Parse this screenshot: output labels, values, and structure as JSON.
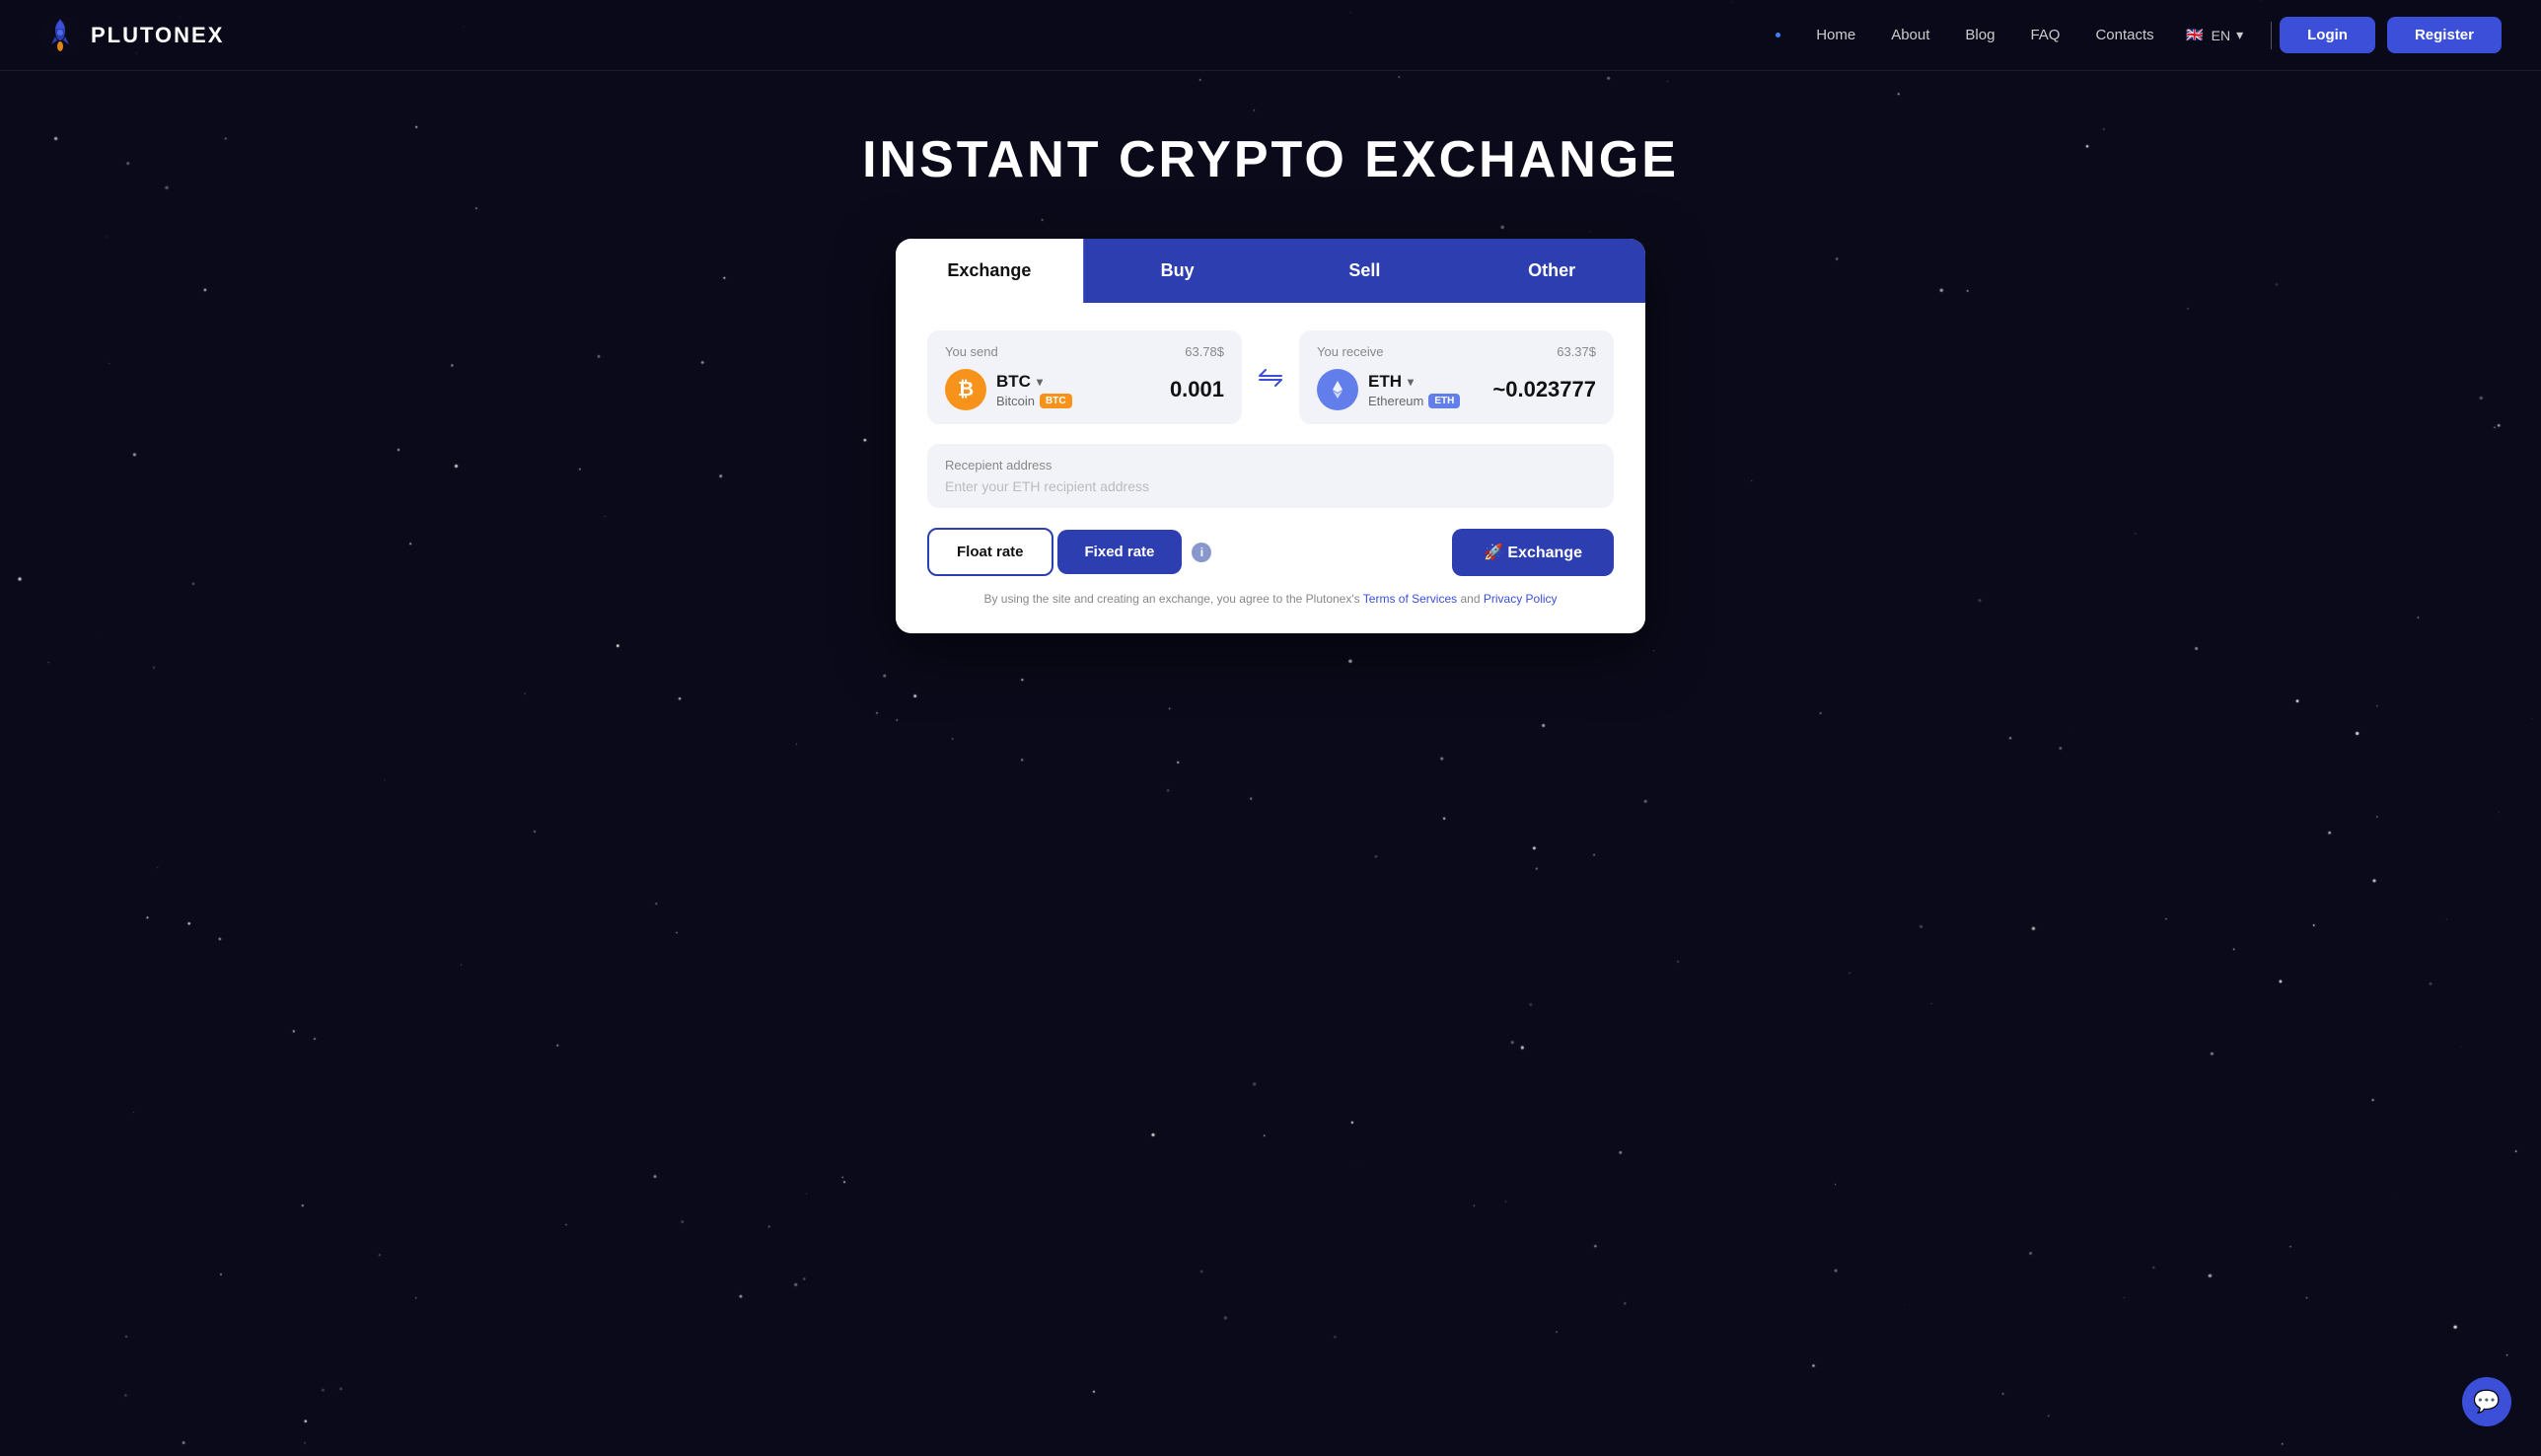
{
  "site": {
    "logo_text": "PLUTONEX",
    "nav_dot": "•"
  },
  "nav": {
    "home": "Home",
    "about": "About",
    "blog": "Blog",
    "faq": "FAQ",
    "contacts": "Contacts",
    "lang": "EN",
    "login": "Login",
    "register": "Register"
  },
  "hero": {
    "title": "INSTANT CRYPTO EXCHANGE"
  },
  "tabs": {
    "exchange": "Exchange",
    "buy": "Buy",
    "sell": "Sell",
    "other": "Other"
  },
  "send": {
    "label": "You send",
    "amount_label": "63.78$",
    "coin_symbol": "BTC",
    "coin_chevron": "▾",
    "coin_full": "Bitcoin",
    "coin_badge": "BTC",
    "value": "0.001"
  },
  "receive": {
    "label": "You receive",
    "amount_label": "63.37$",
    "coin_symbol": "ETH",
    "coin_chevron": "▾",
    "coin_full": "Ethereum",
    "coin_badge": "ETH",
    "value": "~0.023777"
  },
  "address": {
    "label": "Recepient address",
    "placeholder": "Enter your ETH recipient address"
  },
  "rates": {
    "float": "Float rate",
    "fixed": "Fixed rate",
    "exchange_btn": "🚀 Exchange"
  },
  "terms": {
    "text_before": "By using the site and creating an exchange, you agree to the Plutonex's",
    "terms_link": "Terms of Services",
    "and": "and",
    "privacy_link": "Privacy Policy"
  },
  "chat": {
    "icon": "💬"
  }
}
